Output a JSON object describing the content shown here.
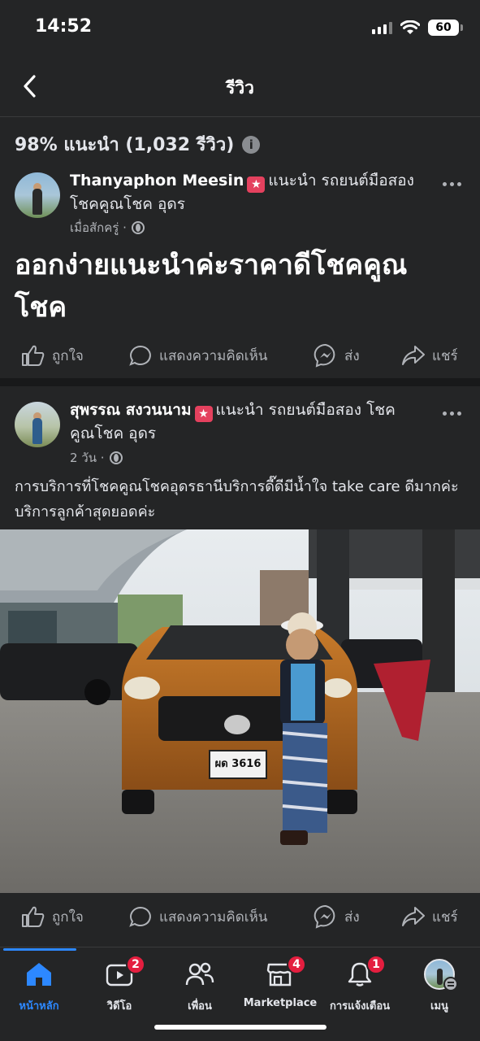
{
  "status_bar": {
    "time": "14:52",
    "battery": "60"
  },
  "nav": {
    "title": "รีวิว"
  },
  "summary": {
    "text": "98% แนะนำ (1,032 รีวิว)"
  },
  "reviews": [
    {
      "author": "Thanyaphon Meesin",
      "text_after_badge": "แนะนำ รถยนต์มือสอง",
      "text_line2": "โชคคูณโชค อุดร",
      "time": "เมื่อสักครู่ ·",
      "body": "ออกง่ายแนะนำค่ะราคาดีโชคคูณโชค"
    },
    {
      "author": "สุพรรณ สงวนนาม",
      "text_after_badge": "แนะนำ รถยนต์มือสอง โชค",
      "text_line2": "คูณโชค อุดร",
      "time": "2 วัน ·",
      "body": "การบริการที่โชคคูณโชคอุดรธานีบริการดี๊ดีมีน้ำใจ take care ดีมากค่ะบริการลูกค้าสุดยอดค่ะ",
      "photo_plate": "ผด 3616"
    }
  ],
  "actions": {
    "like": "ถูกใจ",
    "comment": "แสดงความคิดเห็น",
    "send": "ส่ง",
    "share": "แชร์"
  },
  "bottom_nav": [
    {
      "label": "หน้าหลัก",
      "icon": "home-icon",
      "badge": ""
    },
    {
      "label": "วิดีโอ",
      "icon": "video-icon",
      "badge": "2"
    },
    {
      "label": "เพื่อน",
      "icon": "friends-icon",
      "badge": ""
    },
    {
      "label": "Marketplace",
      "icon": "marketplace-icon",
      "badge": "4"
    },
    {
      "label": "การแจ้งเตือน",
      "icon": "bell-icon",
      "badge": "1"
    },
    {
      "label": "เมนู",
      "icon": "profile-avatar",
      "badge": ""
    }
  ],
  "colors": {
    "background": "#242526",
    "accent": "#2d88ff",
    "badge_red": "#e41e3f",
    "recommend_badge": "#e4415e"
  }
}
